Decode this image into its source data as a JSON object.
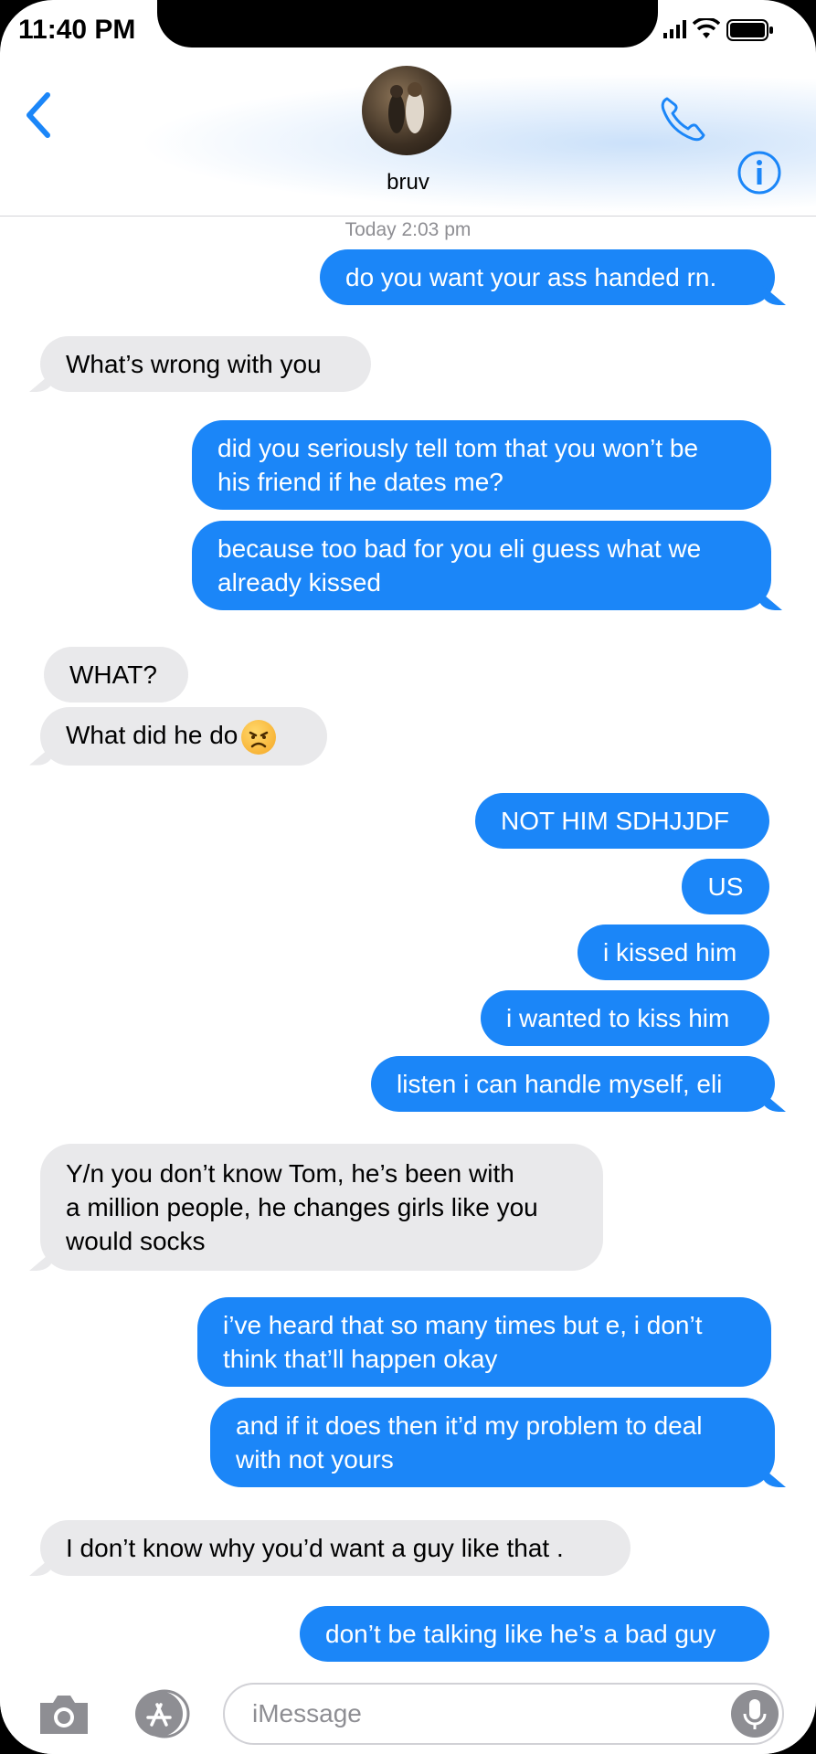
{
  "status_bar": {
    "time": "11:40 PM"
  },
  "header": {
    "contact_name": "bruv",
    "colors": {
      "accent": "#1b86f8"
    }
  },
  "conversation": {
    "timestamp": "Today 2:03 pm",
    "messages": [
      {
        "from": "me",
        "text": "do you want your ass handed rn."
      },
      {
        "from": "them",
        "text": "What’s wrong with you"
      },
      {
        "from": "me",
        "lines": [
          "did you seriously tell tom that you won’t be",
          "his friend if he dates me?"
        ]
      },
      {
        "from": "me",
        "lines": [
          "because too bad for you eli guess what we",
          "already kissed"
        ]
      },
      {
        "from": "them",
        "text": "WHAT?"
      },
      {
        "from": "them",
        "text": "What did he do",
        "emoji": "angry-face-icon"
      },
      {
        "from": "me",
        "text": "NOT HIM SDHJJDF"
      },
      {
        "from": "me",
        "text": "US"
      },
      {
        "from": "me",
        "text": "i kissed him"
      },
      {
        "from": "me",
        "text": "i wanted to kiss him"
      },
      {
        "from": "me",
        "text": "listen i can handle myself, eli"
      },
      {
        "from": "them",
        "lines": [
          "Y/n you don’t know Tom, he’s been with",
          "a million people, he changes girls like you",
          "would socks"
        ]
      },
      {
        "from": "me",
        "lines": [
          "i’ve heard that so many times but e, i don’t",
          "think that’ll happen okay"
        ]
      },
      {
        "from": "me",
        "lines": [
          "and if it does then it’d my problem to deal",
          "with not yours"
        ]
      },
      {
        "from": "them",
        "text": "I don’t know why you’d want a guy like that ."
      },
      {
        "from": "me",
        "text": "don’t be talking like he’s a bad guy"
      }
    ]
  },
  "composer": {
    "placeholder": "iMessage"
  },
  "colors": {
    "sent_bubble": "#1b86f8",
    "received_bubble": "#e9e9eb"
  }
}
